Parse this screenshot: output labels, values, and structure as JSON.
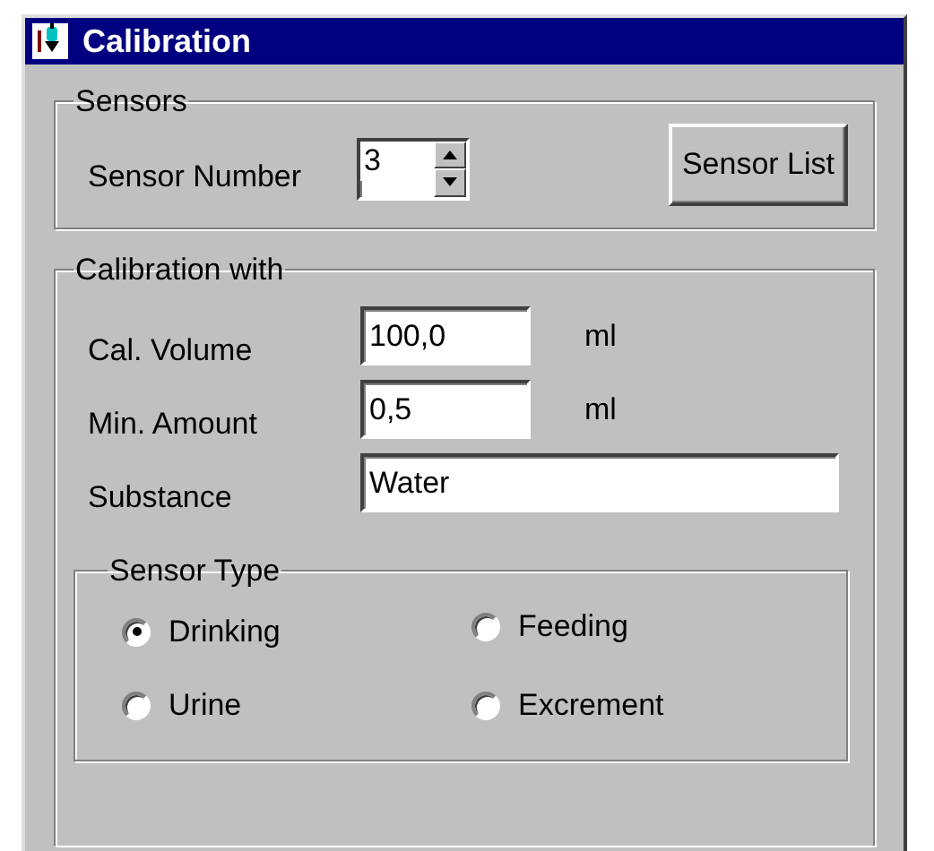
{
  "window": {
    "title": "Calibration"
  },
  "sensors": {
    "title": "Sensors",
    "sensor_number": {
      "label": "Sensor Number",
      "value": "3"
    },
    "sensor_list_button": {
      "label": "Sensor List"
    }
  },
  "calibration": {
    "title": "Calibration with",
    "fields": [
      {
        "label": "Cal. Volume",
        "value": "100,0",
        "unit": "ml",
        "kind": "short"
      },
      {
        "label": "Min. Amount",
        "value": "0,5",
        "unit": "ml",
        "kind": "short"
      },
      {
        "label": "Substance",
        "value": "Water",
        "kind": "wide"
      }
    ],
    "sensor_type": {
      "title": "Sensor Type",
      "options": [
        {
          "label": "Drinking",
          "selected": true
        },
        {
          "label": "Feeding",
          "selected": false
        },
        {
          "label": "Urine",
          "selected": false
        },
        {
          "label": "Excrement",
          "selected": false
        }
      ]
    }
  }
}
